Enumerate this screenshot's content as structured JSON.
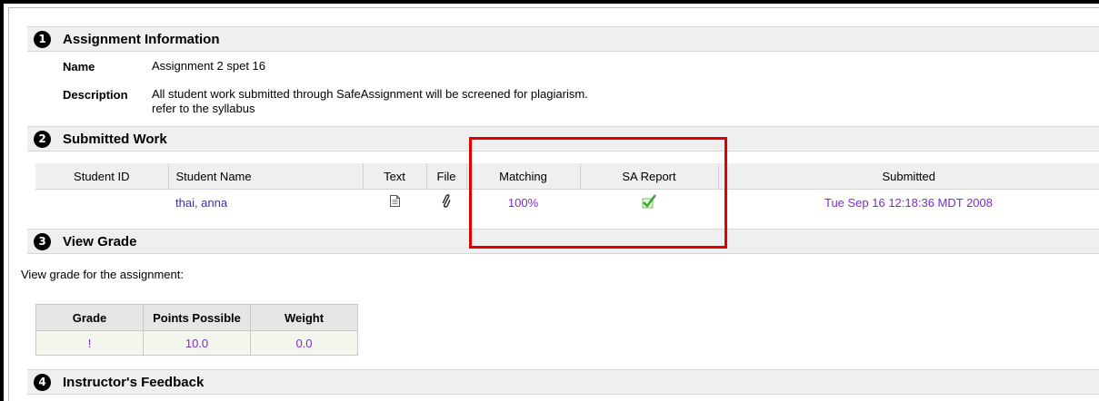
{
  "sections": {
    "s1": {
      "number": "1",
      "title": "Assignment Information"
    },
    "s2": {
      "number": "2",
      "title": "Submitted Work"
    },
    "s3": {
      "number": "3",
      "title": "View Grade"
    },
    "s4": {
      "number": "4",
      "title": "Instructor's Feedback"
    }
  },
  "assignment": {
    "name_label": "Name",
    "name_value": "Assignment 2 spet 16",
    "description_label": "Description",
    "description_line1": "All student work submitted through SafeAssignment will be screened for plagiarism.",
    "description_line2": "refer to the syllabus"
  },
  "submitted_work": {
    "headers": {
      "student_id": "Student ID",
      "student_name": "Student Name",
      "text": "Text",
      "file": "File",
      "matching": "Matching",
      "sa_report": "SA Report",
      "submitted": "Submitted"
    },
    "row": {
      "student_id": "",
      "student_name": "thai, anna",
      "text_icon": "document-icon",
      "file_icon": "paperclip-icon",
      "matching": "100%",
      "sa_report_icon": "checkmark-icon",
      "submitted": "Tue Sep 16 12:18:36 MDT 2008"
    }
  },
  "grade": {
    "intro": "View grade for the assignment:",
    "headers": {
      "grade": "Grade",
      "points": "Points Possible",
      "weight": "Weight"
    },
    "values": {
      "grade": "!",
      "points": "10.0",
      "weight": "0.0"
    }
  },
  "colors": {
    "link_purple": "#7a2ec9",
    "link_blue": "#3333aa",
    "highlight_red": "#e00000",
    "section_bg": "#efefef",
    "check_green": "#3aa83a"
  }
}
